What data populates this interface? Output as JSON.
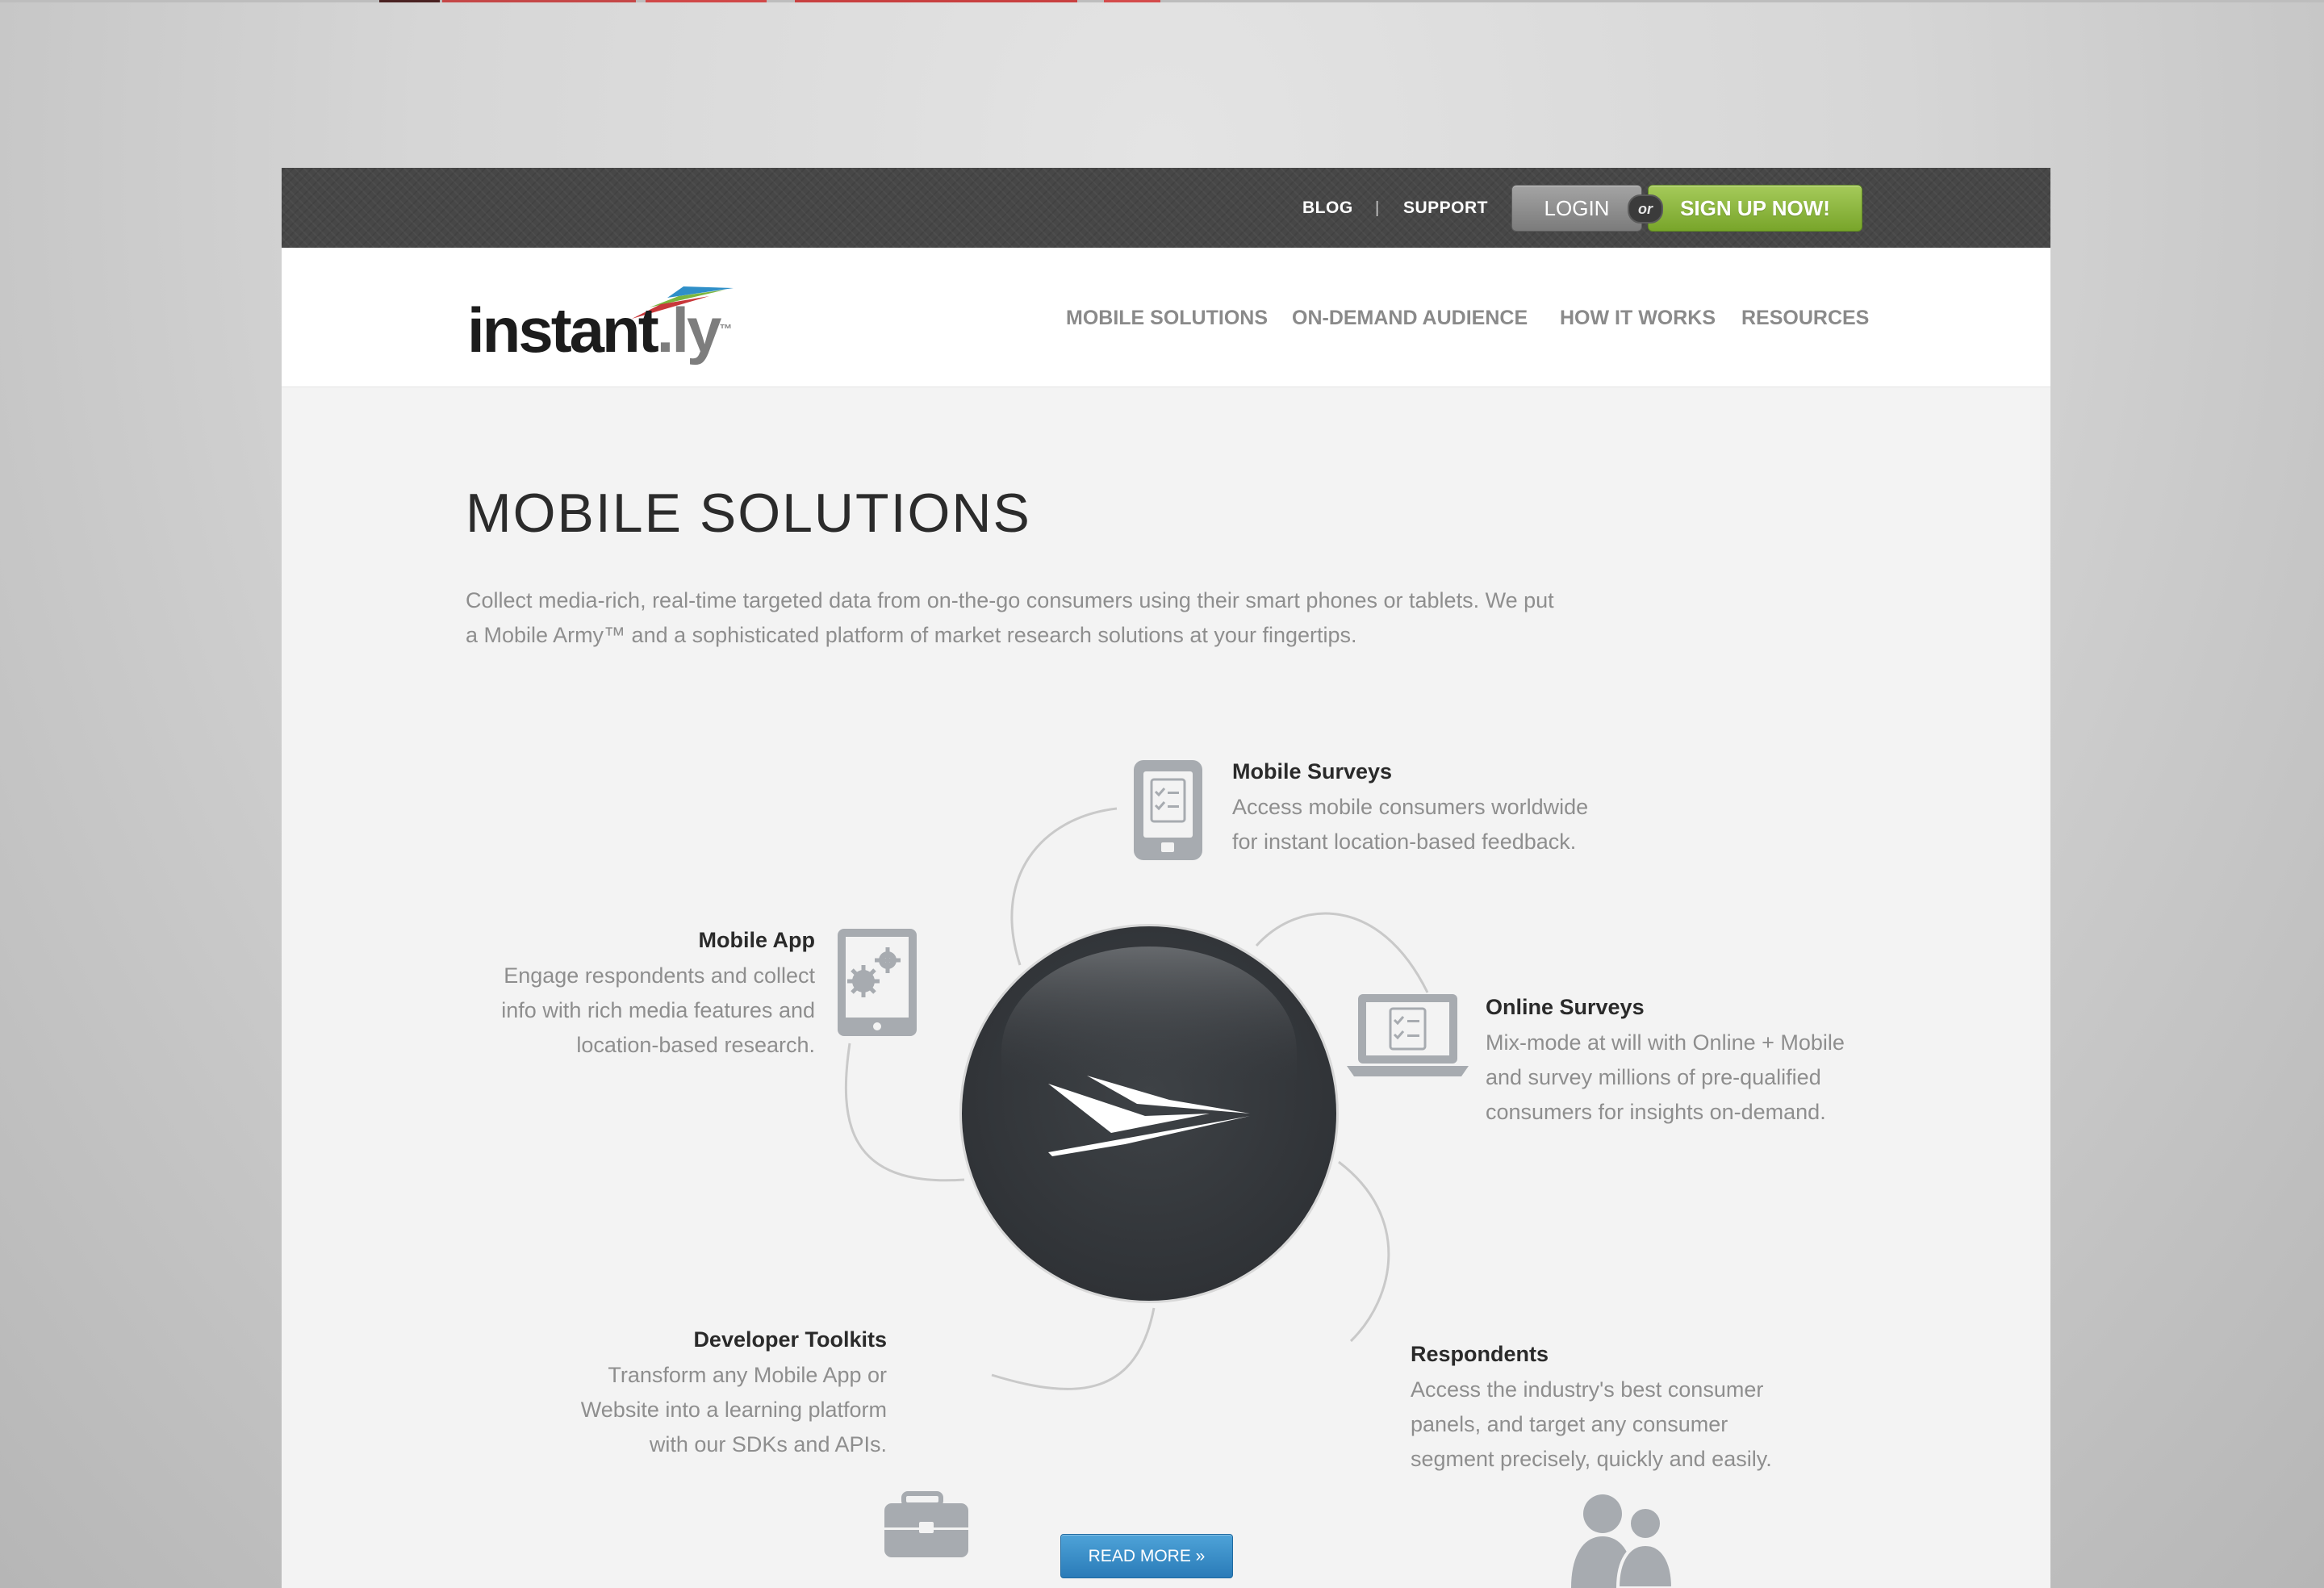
{
  "utility_bar": {
    "blog": "BLOG",
    "separator": "|",
    "support": "SUPPORT",
    "login": "LOGIN",
    "or": "or",
    "signup": "SIGN UP NOW!"
  },
  "logo": {
    "main": "instant",
    "suffix": ".ly",
    "tm": "™"
  },
  "nav": {
    "items": [
      "MOBILE SOLUTIONS",
      "ON-DEMAND AUDIENCE",
      "HOW IT WORKS",
      "RESOURCES"
    ]
  },
  "main": {
    "title": "MOBILE SOLUTIONS",
    "intro_line1": "Collect media-rich, real-time targeted data from on-the-go consumers using their smart phones or tablets. We put",
    "intro_line2": "a Mobile Army™ and a sophisticated platform of market research solutions at your fingertips."
  },
  "features": {
    "mobile_surveys": {
      "title": "Mobile Surveys",
      "lines": [
        "Access mobile consumers worldwide",
        "for instant location-based feedback."
      ]
    },
    "mobile_app": {
      "title": "Mobile App",
      "lines": [
        "Engage respondents and collect",
        "info with rich media features and",
        "location-based research."
      ]
    },
    "online_surveys": {
      "title": "Online Surveys",
      "lines": [
        "Mix-mode at will with Online + Mobile",
        "and survey millions of pre-qualified",
        "consumers for insights on-demand."
      ]
    },
    "developer_toolkits": {
      "title": "Developer Toolkits",
      "lines": [
        "Transform any Mobile App or",
        "Website into a learning platform",
        "with our SDKs and APIs."
      ]
    },
    "respondents": {
      "title": "Respondents",
      "lines": [
        "Access the industry's best consumer",
        "panels, and target any consumer",
        "segment precisely, quickly and easily."
      ]
    }
  },
  "read_more": "READ MORE »",
  "colors": {
    "topbar": "#474747",
    "login_button": "#8f8f8f",
    "signup_button": "#8cb843",
    "read_more_button": "#3a8fcb",
    "hub": "#34373b",
    "icon_gray": "#a7abb0"
  }
}
